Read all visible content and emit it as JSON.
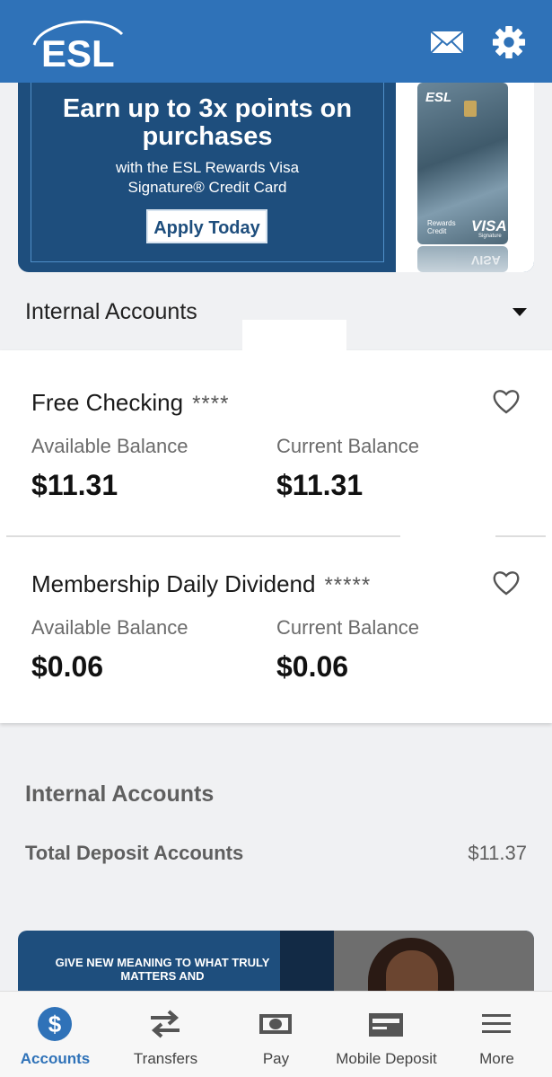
{
  "header": {
    "logo_text": "ESL",
    "brand_color": "#2f72b8",
    "icons": [
      "mail-icon",
      "gear-icon"
    ]
  },
  "promo_banner": {
    "headline": "Earn up to 3x points on purchases",
    "sub_line1": "with the ESL Rewards Visa",
    "sub_line2": "Signature® Credit Card",
    "button_label": "Apply Today",
    "card": {
      "issuer": "ESL",
      "product": "Rewards Credit",
      "network": "VISA",
      "tier": "Signature"
    }
  },
  "section": {
    "title": "Internal Accounts"
  },
  "accounts": [
    {
      "name": "Free Checking",
      "mask": "****",
      "available_label": "Available Balance",
      "available_value": "$11.31",
      "current_label": "Current Balance",
      "current_value": "$11.31"
    },
    {
      "name": "Membership Daily Dividend",
      "mask": "*****",
      "available_label": "Available Balance",
      "available_value": "$0.06",
      "current_label": "Current Balance",
      "current_value": "$0.06"
    }
  ],
  "summary": {
    "title": "Internal Accounts",
    "label": "Total Deposit Accounts",
    "value": "$11.37"
  },
  "promo_bottom": {
    "text": "GIVE NEW MEANING TO WHAT TRULY MATTERS AND"
  },
  "bottom_nav": [
    {
      "label": "Accounts",
      "icon": "dollar-circle-icon",
      "active": true
    },
    {
      "label": "Transfers",
      "icon": "transfer-arrows-icon",
      "active": false
    },
    {
      "label": "Pay",
      "icon": "cash-icon",
      "active": false
    },
    {
      "label": "Mobile Deposit",
      "icon": "check-deposit-icon",
      "active": false
    },
    {
      "label": "More",
      "icon": "menu-icon",
      "active": false
    }
  ]
}
